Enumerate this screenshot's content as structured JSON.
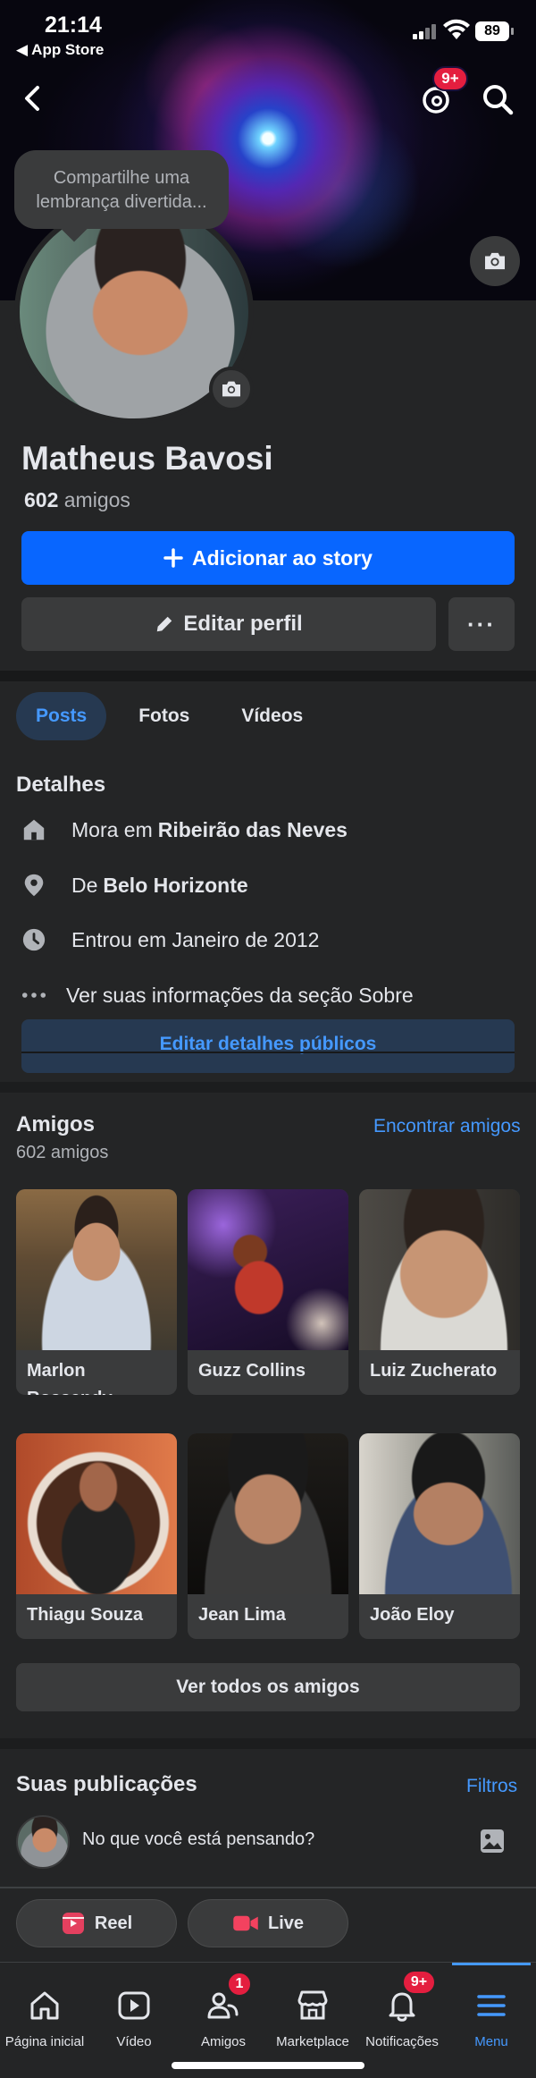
{
  "status_bar": {
    "time": "21:14",
    "back_app": "◀ App Store",
    "battery": "89"
  },
  "header": {
    "threads_badge": "9+",
    "memory_prompt": "Compartilhe uma lembrança divertida..."
  },
  "profile": {
    "name": "Matheus Bavosi",
    "friend_count": "602",
    "friend_word": "amigos",
    "add_story_label": "Adicionar ao story",
    "edit_profile_label": "Editar perfil",
    "more_label": "···"
  },
  "tabs": [
    {
      "label": "Posts",
      "active": true
    },
    {
      "label": "Fotos",
      "active": false
    },
    {
      "label": "Vídeos",
      "active": false
    }
  ],
  "details": {
    "title": "Detalhes",
    "lives_prefix": "Mora em",
    "lives_city": "Ribeirão das Neves",
    "from_prefix": "De",
    "from_city": "Belo Horizonte",
    "joined": "Entrou em Janeiro de 2012",
    "about_link": "Ver suas informações da seção Sobre",
    "edit_public_label": "Editar detalhes públicos"
  },
  "friends": {
    "title": "Amigos",
    "find_label": "Encontrar amigos",
    "count_label": "602 amigos",
    "items": [
      {
        "name": "Marlon Rossendy"
      },
      {
        "name": "Guzz Collins"
      },
      {
        "name": "Luiz Zucherato"
      },
      {
        "name": "Thiagu Souza"
      },
      {
        "name": "Jean Lima"
      },
      {
        "name": "João Eloy"
      }
    ],
    "see_all_label": "Ver todos os amigos"
  },
  "posts": {
    "title": "Suas publicações",
    "filters_label": "Filtros",
    "composer_placeholder": "No que você está pensando?",
    "reel_label": "Reel",
    "live_label": "Live"
  },
  "bottom_nav": {
    "items": [
      {
        "label": "Página inicial",
        "icon": "home-icon"
      },
      {
        "label": "Vídeo",
        "icon": "video-icon"
      },
      {
        "label": "Amigos",
        "icon": "friends-icon",
        "badge": "1"
      },
      {
        "label": "Marketplace",
        "icon": "marketplace-icon"
      },
      {
        "label": "Notificações",
        "icon": "bell-icon",
        "badge": "9+"
      },
      {
        "label": "Menu",
        "icon": "menu-icon",
        "active": true
      }
    ]
  },
  "colors": {
    "accent": "#0866ff",
    "link": "#4599ff",
    "background": "#242526",
    "badge": "#e41e3f"
  }
}
